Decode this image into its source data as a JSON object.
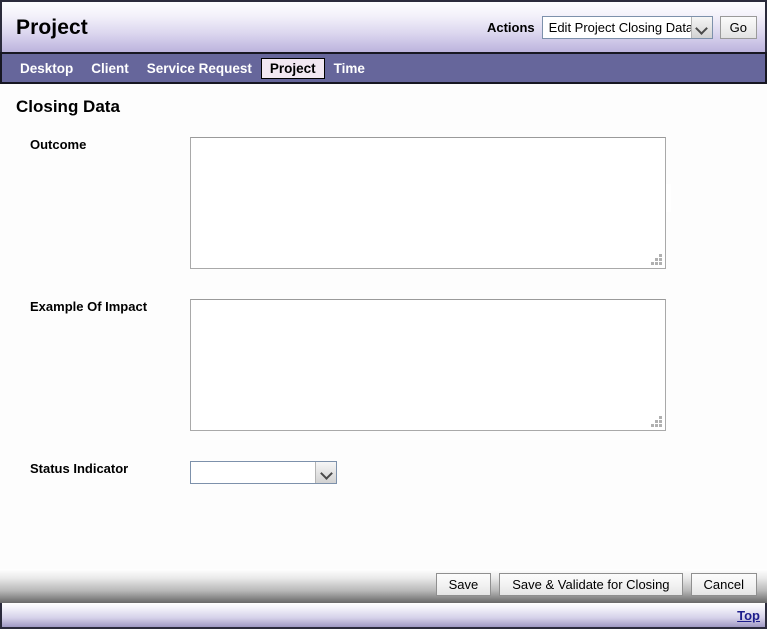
{
  "banner": {
    "title": "Project",
    "actions_label": "Actions",
    "actions_select_value": "Edit Project Closing Data",
    "go_button": "Go"
  },
  "nav": {
    "items": [
      {
        "label": "Desktop",
        "active": false
      },
      {
        "label": "Client",
        "active": false
      },
      {
        "label": "Service Request",
        "active": false
      },
      {
        "label": "Project",
        "active": true
      },
      {
        "label": "Time",
        "active": false
      }
    ]
  },
  "page": {
    "title": "Closing Data",
    "stray_mark": "."
  },
  "form": {
    "outcome": {
      "label": "Outcome",
      "value": "",
      "placeholder": ""
    },
    "example_of_impact": {
      "label": "Example Of Impact",
      "value": "",
      "placeholder": ""
    },
    "status_indicator": {
      "label": "Status Indicator",
      "value": "",
      "options": [
        ""
      ]
    }
  },
  "footer": {
    "save_label": "Save",
    "save_validate_label": "Save & Validate for Closing",
    "cancel_label": "Cancel",
    "top_link": "Top"
  },
  "colors": {
    "nav_bar": "#66669b",
    "banner_bottom": "#bcb3dd",
    "active_tab_bg": "#f2e8f2",
    "link": "#1d1d8c",
    "border_dark": "#2b2b3c"
  },
  "icons": {
    "chevron_down": "chevron-down-icon",
    "resize_grip": "resize-grip-icon"
  }
}
